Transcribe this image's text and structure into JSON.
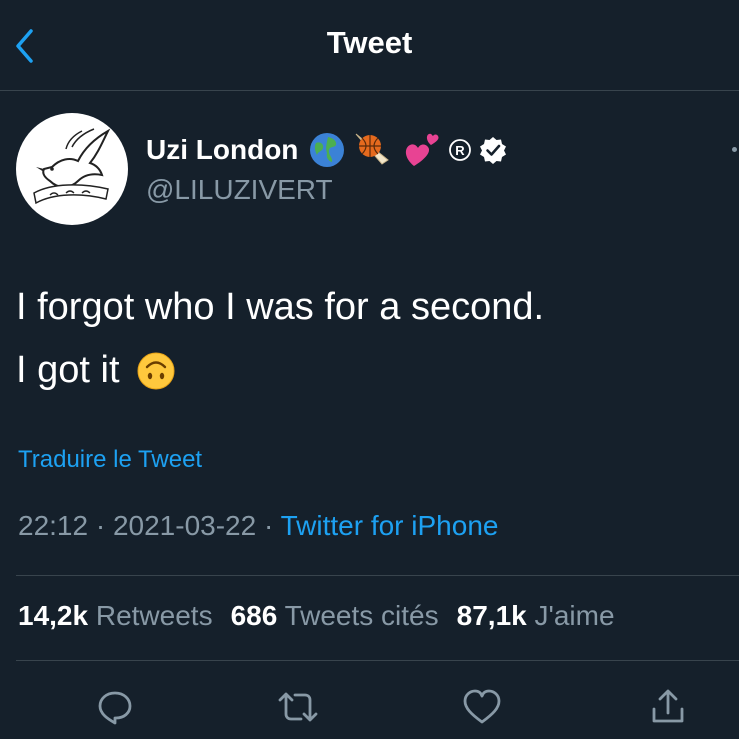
{
  "header": {
    "title": "Tweet",
    "back_icon": "chevron-left-icon"
  },
  "author": {
    "display_name": "Uzi London",
    "handle": "@LILUZIVERT",
    "name_emojis": [
      "earth-globe-icon",
      "basketball-icon",
      "two-hearts-icon",
      "registered-icon"
    ],
    "verified_icon": "verified-badge-icon",
    "avatar_icon": "dove-logo-icon"
  },
  "tweet": {
    "line1": "I forgot who I was for a second.",
    "line2": "I got it",
    "line2_emoji": "upside-down-face-icon"
  },
  "translate_label": "Traduire le Tweet",
  "meta": {
    "time": "22:12",
    "separator1": " · ",
    "date": "2021-03-22",
    "separator2": " · ",
    "source": "Twitter for iPhone"
  },
  "stats": {
    "retweets_count": "14,2k",
    "retweets_label": "Retweets",
    "quotes_count": "686",
    "quotes_label": "Tweets cités",
    "likes_count": "87,1k",
    "likes_label": "J'aime"
  },
  "actions": [
    "reply-icon",
    "retweet-icon",
    "like-icon",
    "share-icon"
  ],
  "colors": {
    "background": "#15202B",
    "accent": "#1DA1F2",
    "secondary_text": "#8899A6",
    "divider": "#38444D"
  }
}
